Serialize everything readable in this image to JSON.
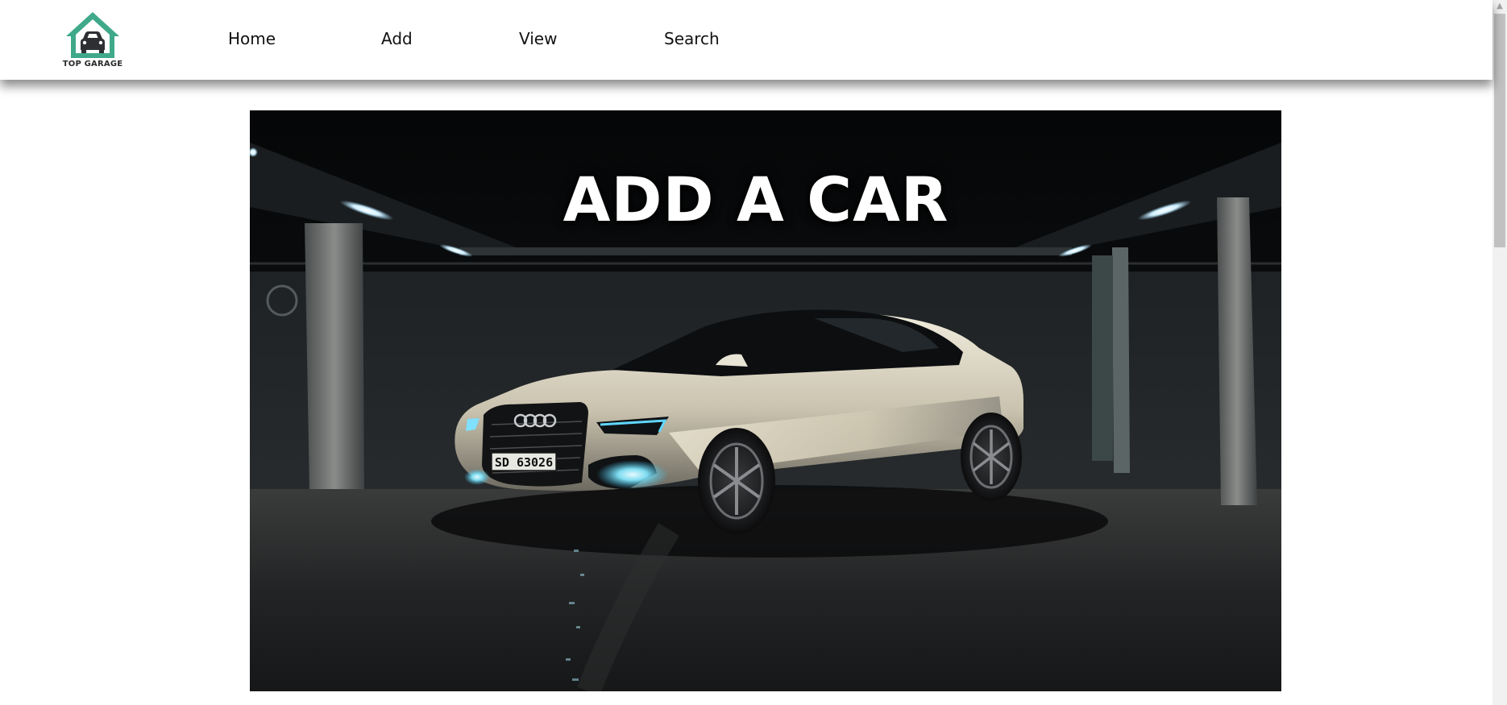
{
  "brand": {
    "name": "TOP GARAGE",
    "accent_color": "#3fa98a",
    "logo_icon": "garage-car-icon"
  },
  "nav": {
    "items": [
      {
        "label": "Home"
      },
      {
        "label": "Add"
      },
      {
        "label": "View"
      },
      {
        "label": "Search"
      }
    ]
  },
  "hero": {
    "title": "ADD A CAR",
    "plate": "SD 63026",
    "image": "white-audi-in-dark-parking-garage"
  },
  "scrollbar": {
    "up_icon": "chevron-up-icon"
  }
}
